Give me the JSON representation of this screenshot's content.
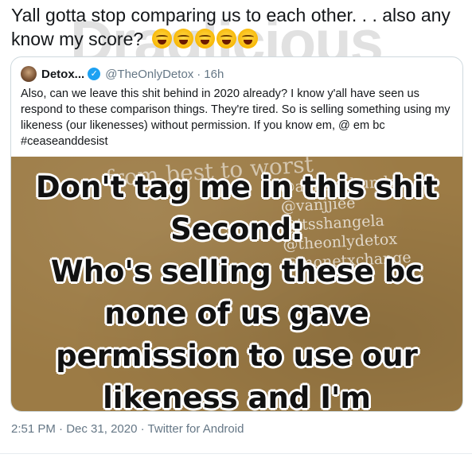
{
  "tweet": {
    "text": "Yall gotta stop comparing us to each other. . . also any know my score?",
    "emojis": [
      "rolling-on-floor-laughing",
      "rolling-on-floor-laughing",
      "rolling-on-floor-laughing",
      "rolling-on-floor-laughing",
      "rolling-on-floor-laughing"
    ],
    "watermark": "Draglicious"
  },
  "quoted": {
    "name": "Detox...",
    "handle": "@TheOnlyDetox",
    "separator": "·",
    "age": "16h",
    "body": "Also, can we leave this shit behind in 2020 already? I know y'all have seen us respond to these comparison things. They're tired. So is selling something using my likeness (our likenesses) without permission. If you know em, @ em bc #ceaseanddesist",
    "media": {
      "background_faint_text": "from best to worst",
      "faint_tags": [
        "@alaskathunder",
        "@vanjjiee",
        "@itsshangela",
        "@theonlydetox",
        "@monetxchange"
      ],
      "lines": [
        "Don't tag me in this shit",
        "Second:",
        "Who's selling these bc",
        "none of us gave",
        "permission to use our",
        "likeness and I'm"
      ],
      "background_color": "#9c7b45"
    }
  },
  "meta": {
    "time": "2:51 PM",
    "date": "Dec 31, 2020",
    "source": "Twitter for Android",
    "separator": "·"
  },
  "colors": {
    "text": "#14171a",
    "secondary": "#657786",
    "verified": "#1da1f2",
    "border": "#cfd9de"
  }
}
